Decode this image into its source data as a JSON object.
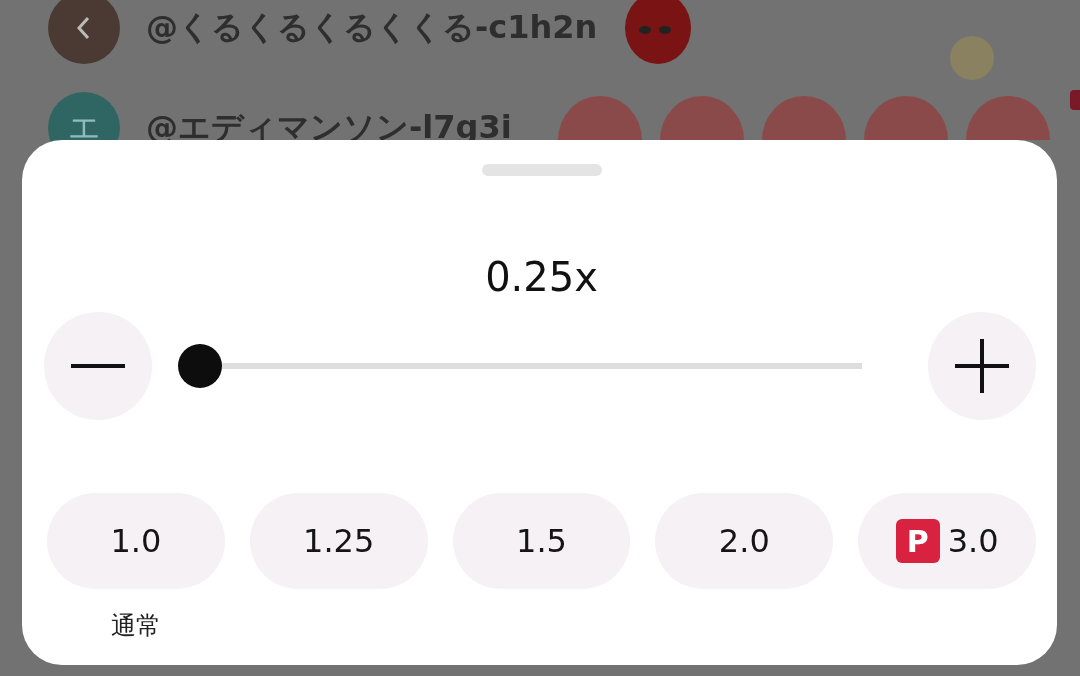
{
  "header": {
    "username": "@くるくるくるくくる-c1h2n"
  },
  "rows": [
    {
      "avatar_letter": "エ",
      "username": "@エディマンソン-l7g3i"
    }
  ],
  "sheet": {
    "speed": "0.25x",
    "slider": {
      "level": 0
    },
    "presets": [
      {
        "label": "1.0",
        "caption": "通常",
        "premium": false
      },
      {
        "label": "1.25",
        "premium": false
      },
      {
        "label": "1.5",
        "premium": false
      },
      {
        "label": "2.0",
        "premium": false
      },
      {
        "label": "3.0",
        "premium": true,
        "badge": "P"
      }
    ]
  }
}
